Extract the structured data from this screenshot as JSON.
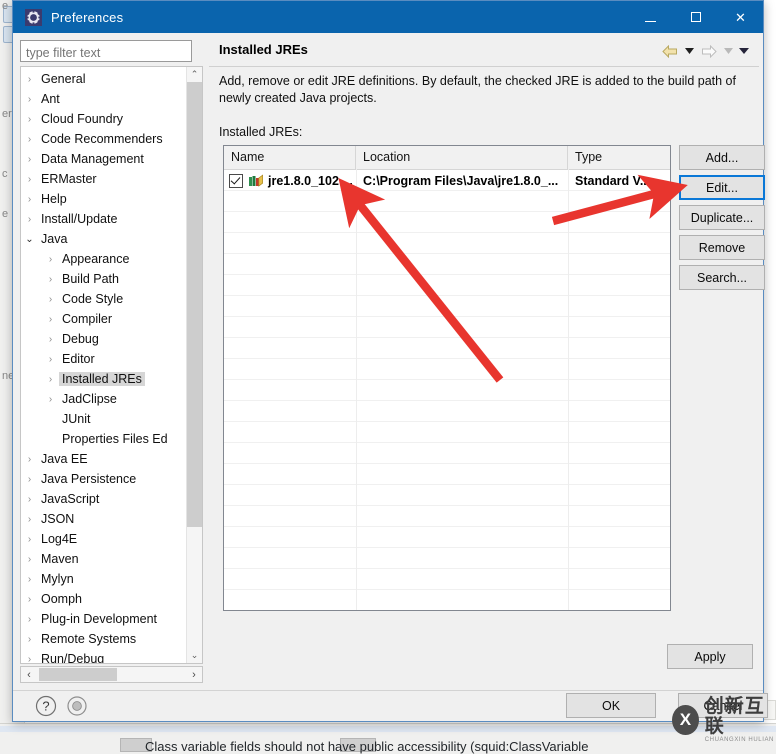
{
  "window": {
    "title": "Preferences",
    "icon": "preferences-gear-icon",
    "controls": {
      "minimize": "–",
      "maximize": "□",
      "close": "✕"
    }
  },
  "filter": {
    "placeholder": "type filter text",
    "value": ""
  },
  "tree": {
    "items": [
      {
        "label": "General",
        "indent": 0,
        "expandable": true,
        "expanded": false,
        "selected": false
      },
      {
        "label": "Ant",
        "indent": 0,
        "expandable": true,
        "expanded": false,
        "selected": false
      },
      {
        "label": "Cloud Foundry",
        "indent": 0,
        "expandable": true,
        "expanded": false,
        "selected": false
      },
      {
        "label": "Code Recommenders",
        "indent": 0,
        "expandable": true,
        "expanded": false,
        "selected": false
      },
      {
        "label": "Data Management",
        "indent": 0,
        "expandable": true,
        "expanded": false,
        "selected": false
      },
      {
        "label": "ERMaster",
        "indent": 0,
        "expandable": true,
        "expanded": false,
        "selected": false
      },
      {
        "label": "Help",
        "indent": 0,
        "expandable": true,
        "expanded": false,
        "selected": false
      },
      {
        "label": "Install/Update",
        "indent": 0,
        "expandable": true,
        "expanded": false,
        "selected": false
      },
      {
        "label": "Java",
        "indent": 0,
        "expandable": true,
        "expanded": true,
        "selected": false
      },
      {
        "label": "Appearance",
        "indent": 1,
        "expandable": true,
        "expanded": false,
        "selected": false
      },
      {
        "label": "Build Path",
        "indent": 1,
        "expandable": true,
        "expanded": false,
        "selected": false
      },
      {
        "label": "Code Style",
        "indent": 1,
        "expandable": true,
        "expanded": false,
        "selected": false
      },
      {
        "label": "Compiler",
        "indent": 1,
        "expandable": true,
        "expanded": false,
        "selected": false
      },
      {
        "label": "Debug",
        "indent": 1,
        "expandable": true,
        "expanded": false,
        "selected": false
      },
      {
        "label": "Editor",
        "indent": 1,
        "expandable": true,
        "expanded": false,
        "selected": false
      },
      {
        "label": "Installed JREs",
        "indent": 1,
        "expandable": true,
        "expanded": false,
        "selected": true
      },
      {
        "label": "JadClipse",
        "indent": 1,
        "expandable": true,
        "expanded": false,
        "selected": false
      },
      {
        "label": "JUnit",
        "indent": 1,
        "expandable": false,
        "expanded": false,
        "selected": false
      },
      {
        "label": "Properties Files Ed",
        "indent": 1,
        "expandable": false,
        "expanded": false,
        "selected": false
      },
      {
        "label": "Java EE",
        "indent": 0,
        "expandable": true,
        "expanded": false,
        "selected": false
      },
      {
        "label": "Java Persistence",
        "indent": 0,
        "expandable": true,
        "expanded": false,
        "selected": false
      },
      {
        "label": "JavaScript",
        "indent": 0,
        "expandable": true,
        "expanded": false,
        "selected": false
      },
      {
        "label": "JSON",
        "indent": 0,
        "expandable": true,
        "expanded": false,
        "selected": false
      },
      {
        "label": "Log4E",
        "indent": 0,
        "expandable": true,
        "expanded": false,
        "selected": false
      },
      {
        "label": "Maven",
        "indent": 0,
        "expandable": true,
        "expanded": false,
        "selected": false
      },
      {
        "label": "Mylyn",
        "indent": 0,
        "expandable": true,
        "expanded": false,
        "selected": false
      },
      {
        "label": "Oomph",
        "indent": 0,
        "expandable": true,
        "expanded": false,
        "selected": false
      },
      {
        "label": "Plug-in Development",
        "indent": 0,
        "expandable": true,
        "expanded": false,
        "selected": false
      },
      {
        "label": "Remote Systems",
        "indent": 0,
        "expandable": true,
        "expanded": false,
        "selected": false
      },
      {
        "label": "Run/Debug",
        "indent": 0,
        "expandable": true,
        "expanded": false,
        "selected": false
      }
    ],
    "collapsed_arrow": "›",
    "expanded_arrow": "⌄",
    "scroll_up_arrow": "⌃",
    "scroll_down_arrow": "⌄",
    "scroll_left_arrow": "‹",
    "scroll_right_arrow": "›"
  },
  "page": {
    "title": "Installed JREs",
    "description": "Add, remove or edit JRE definitions. By default, the checked JRE is added to the build path of newly created Java projects.",
    "table_label": "Installed JREs:",
    "nav": {
      "back_icon": "back-arrow-icon",
      "back_menu_icon": "chevron-down-icon",
      "forward_icon": "forward-arrow-icon",
      "forward_menu_icon": "chevron-down-icon",
      "menu_icon": "chevron-down-icon"
    }
  },
  "table": {
    "columns": [
      "Name",
      "Location",
      "Type"
    ],
    "rows": [
      {
        "checked": true,
        "icon": "jre-library-icon",
        "name": "jre1.8.0_102 ...",
        "location": "C:\\Program Files\\Java\\jre1.8.0_...",
        "type": "Standard V..."
      }
    ]
  },
  "side_buttons": [
    {
      "label": "Add...",
      "focused": false
    },
    {
      "label": "Edit...",
      "focused": true
    },
    {
      "label": "Duplicate...",
      "focused": false
    },
    {
      "label": "Remove",
      "focused": false
    },
    {
      "label": "Search...",
      "focused": false
    }
  ],
  "apply_button": {
    "label": "Apply"
  },
  "footer": {
    "help_icon": "help-question-icon",
    "round_icon": "target-circle-icon",
    "ok_label": "OK",
    "cancel_label": "Cancel"
  },
  "watermark": {
    "mark": "X",
    "cn": "创新互联",
    "en": "CHUANGXIN HULIAN"
  },
  "background": {
    "status_text": "Class variable fields should not have public accessibility (squid:ClassVariable"
  },
  "colors": {
    "title_bar": "#0a64ad",
    "dialog_bg": "#f0f0f0",
    "focus_blue": "#0a78d7",
    "annotation_red": "#e8352e",
    "selection_gray": "#d6d6d6"
  }
}
